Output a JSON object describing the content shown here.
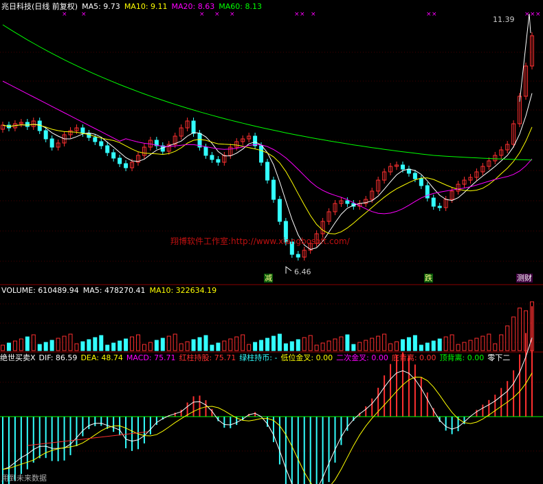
{
  "header": {
    "title": "兆日科技(日线 前复权)",
    "ma5": "MA5: 9.73",
    "ma10": "MA10: 9.11",
    "ma20": "MA20: 8.63",
    "ma60": "MA60: 8.13"
  },
  "main": {
    "high_label": "11.39",
    "low_label": "6.46",
    "watermark": "翔博软件工作室:http://www.xiangbosoft.com/",
    "signals": [
      "减",
      "跌",
      "测"
    ],
    "signal_last_suffix": "财"
  },
  "volume": {
    "label": "VOLUME: 610489.94",
    "ma5": "MA5: 478270.41",
    "ma10": "MA10: 322634.19"
  },
  "indicator": {
    "name": "绝世买卖X",
    "dif": "DIF: 86.59",
    "dea": "DEA: 48.74",
    "macd": "MACD: 75.71",
    "hold_red": "红柱持股: 75.71",
    "hold_green": "绿柱持币: -",
    "low_cross": "低位金叉: 0.00",
    "second_cross": "二次金叉: 0.00",
    "bottom_div": "底背离: 0.00",
    "top_div": "顶背离: 0.00",
    "zero_cross": "零下二",
    "footer": "用到未来数据"
  },
  "colors": {
    "up": "#ff3030",
    "down": "#33ffff",
    "ma5": "#ffffff",
    "ma10": "#ffff00",
    "ma20": "#ff00ff",
    "ma60": "#00ff00",
    "grid": "#8b0000"
  }
}
